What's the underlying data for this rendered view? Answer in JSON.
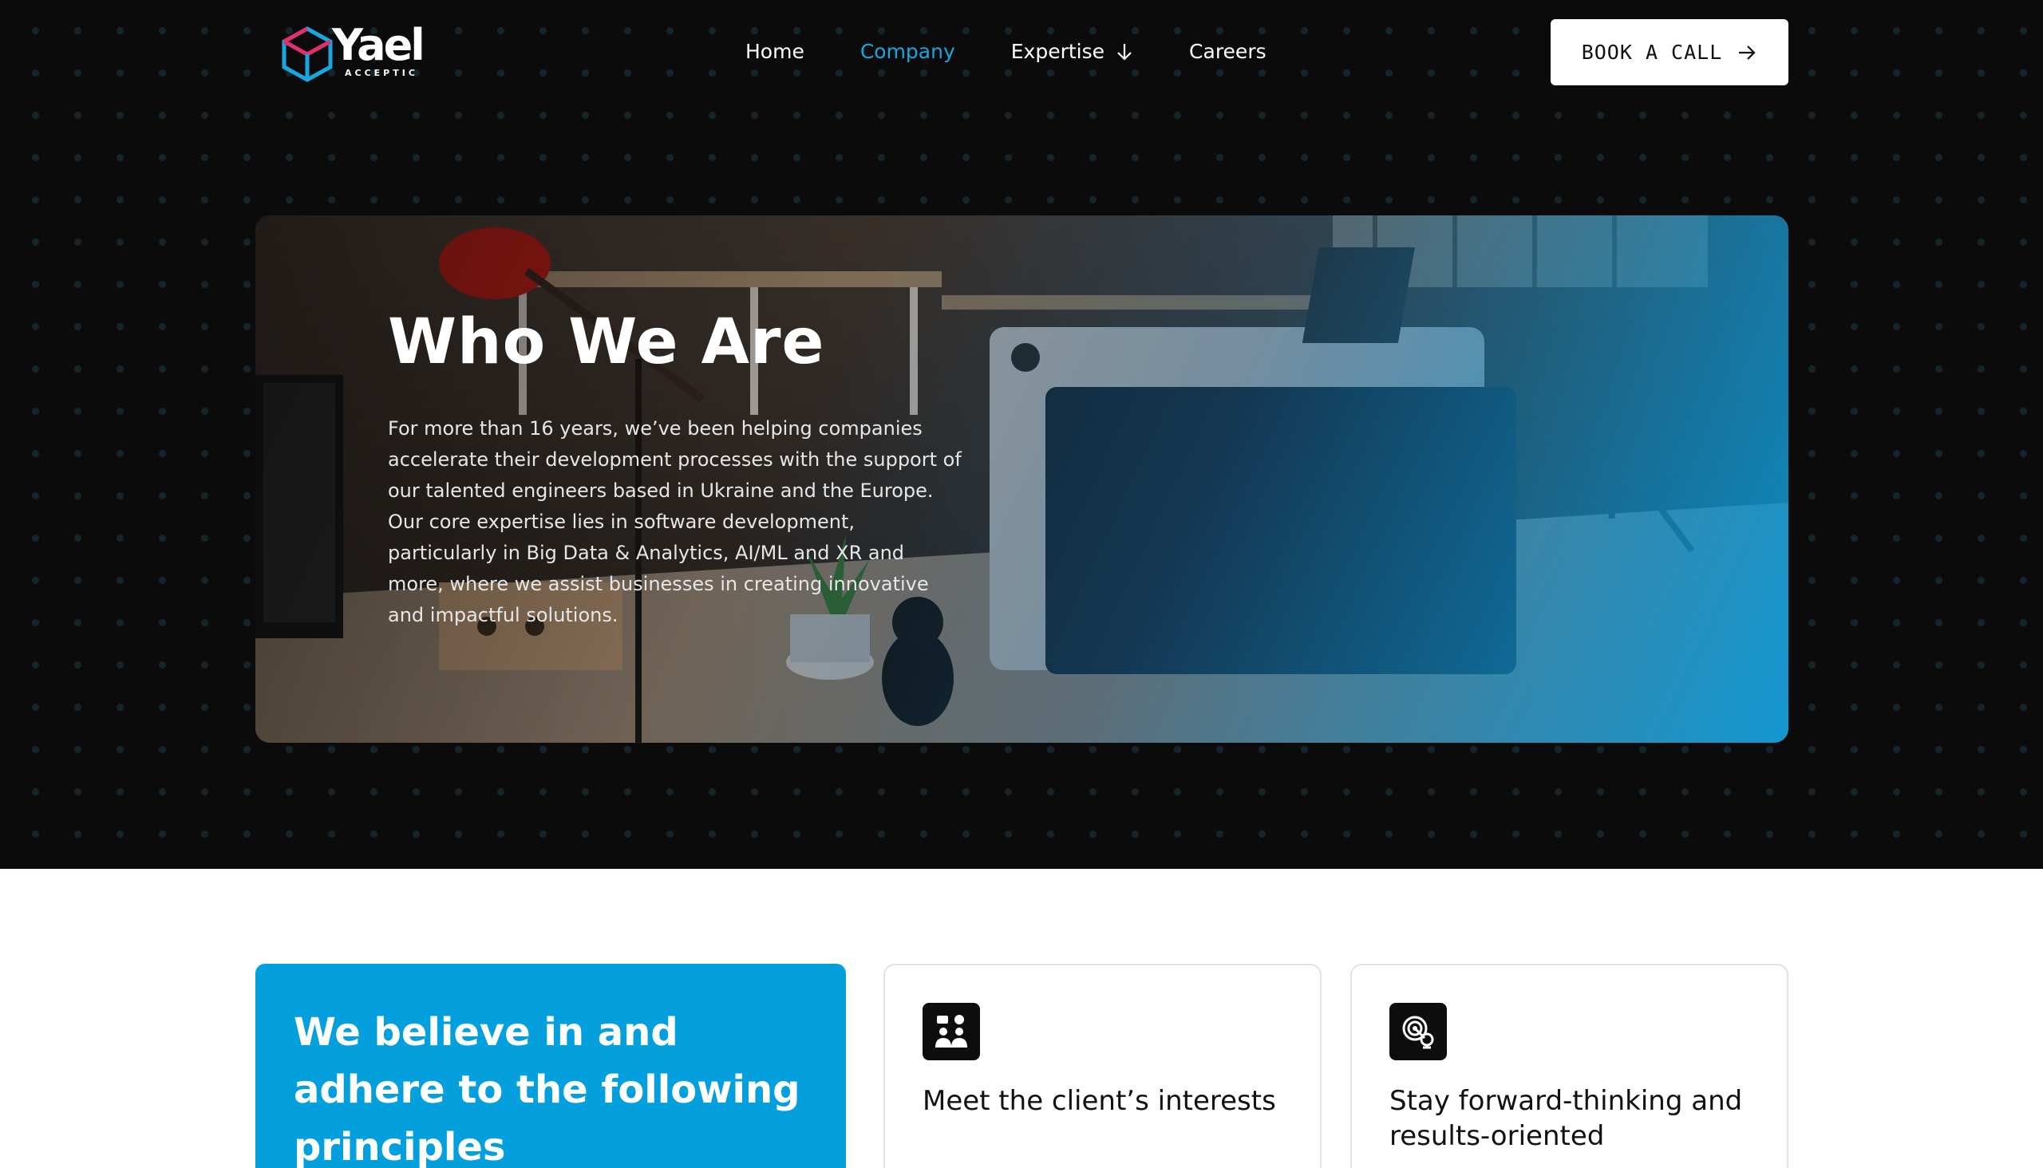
{
  "brand": {
    "name": "Yael",
    "tagline": "ACCEPTIC"
  },
  "nav": {
    "items": [
      {
        "label": "Home"
      },
      {
        "label": "Company"
      },
      {
        "label": "Expertise"
      },
      {
        "label": "Careers"
      }
    ],
    "active": "Company",
    "cta_label": "BOOK A CALL"
  },
  "hero": {
    "title": "Who We Are",
    "description": "For more than 16 years, we’ve been helping companies accelerate their development processes with the support of our talented engineers based in Ukraine and the Europe. Our core expertise lies in software development, particularly in Big Data & Analytics, AI/ML and XR and more, where we assist businesses in creating innovative and impactful solutions."
  },
  "principles": {
    "heading": "We believe in and adhere to the following principles",
    "cards": [
      {
        "title": "Meet the client’s interests",
        "icon": "team-chat-icon"
      },
      {
        "title": "Stay forward-thinking and results-oriented",
        "icon": "target-gear-icon"
      }
    ]
  },
  "colors": {
    "accent": "#19a6df",
    "card_blue": "#04a0de",
    "background_dark": "#0b0b0c"
  }
}
